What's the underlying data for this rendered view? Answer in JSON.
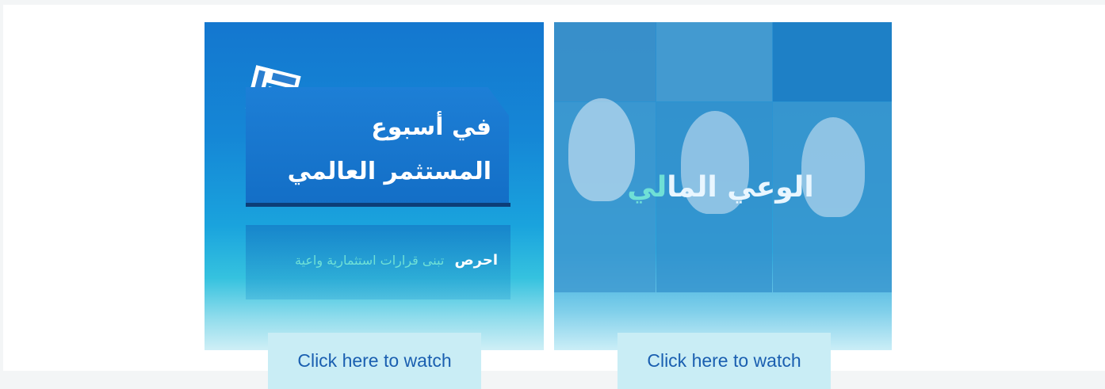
{
  "cards": [
    {
      "title_line1": "في أسبوع",
      "title_line2": "المستثمر العالمي",
      "subtitle_strong": "احرص",
      "subtitle_rest": "تبنى قرارات استثمارية واعية",
      "button_label": "Click here to watch"
    },
    {
      "title_main": "الوعي الما",
      "title_accent": "لي",
      "button_label": "Click here to watch"
    }
  ],
  "colors": {
    "button_bg": "#c9edf5",
    "button_text": "#1a5fb0",
    "accent_teal": "#6fe0d6"
  }
}
